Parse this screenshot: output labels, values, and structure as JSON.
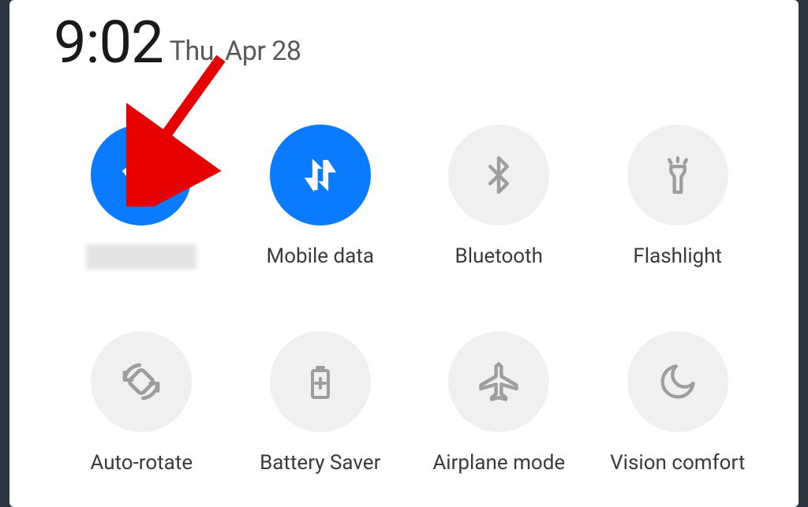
{
  "header": {
    "time": "9:02",
    "date": "Thu, Apr 28"
  },
  "tiles": {
    "wifi": {
      "active": true,
      "label_redacted": true
    },
    "mobile_data": {
      "active": true,
      "label": "Mobile data"
    },
    "bluetooth": {
      "active": false,
      "label": "Bluetooth"
    },
    "flashlight": {
      "active": false,
      "label": "Flashlight"
    },
    "auto_rotate": {
      "active": false,
      "label": "Auto-rotate"
    },
    "battery_saver": {
      "active": false,
      "label": "Battery Saver"
    },
    "airplane": {
      "active": false,
      "label": "Airplane mode"
    },
    "vision_comfort": {
      "active": false,
      "label": "Vision comfort"
    }
  },
  "annotation": {
    "arrow_color": "#e70000",
    "target": "wifi"
  }
}
